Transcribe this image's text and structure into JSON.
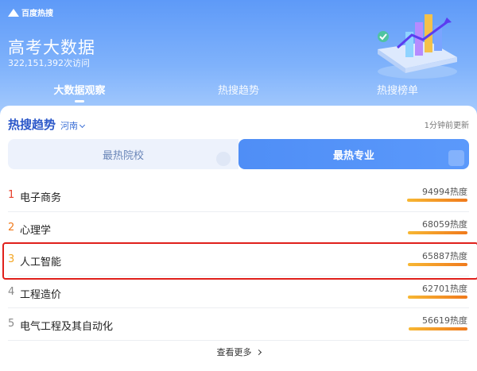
{
  "brand": {
    "name": "百度热搜"
  },
  "header": {
    "title": "高考大数据",
    "visits": "322,151,392次访问",
    "tabs": [
      "大数据观察",
      "热搜趋势",
      "热搜榜单"
    ]
  },
  "card": {
    "title": "热搜趋势",
    "region": "河南",
    "updated": "1分钟前更新",
    "segments": [
      "最热院校",
      "最热专业"
    ],
    "active_segment": "最热专业",
    "more_label": "查看更多"
  },
  "list": [
    {
      "rank": "1",
      "name": "电子商务",
      "heat": "94994热度",
      "heat_value": 94994,
      "rank_color": "#e8412c"
    },
    {
      "rank": "2",
      "name": "心理学",
      "heat": "68059热度",
      "heat_value": 68059,
      "rank_color": "#f07a1c"
    },
    {
      "rank": "3",
      "name": "人工智能",
      "heat": "65887热度",
      "heat_value": 65887,
      "rank_color": "#f4a623"
    },
    {
      "rank": "4",
      "name": "工程造价",
      "heat": "62701热度",
      "heat_value": 62701,
      "rank_color": "#888888"
    },
    {
      "rank": "5",
      "name": "电气工程及其自动化",
      "heat": "56619热度",
      "heat_value": 56619,
      "rank_color": "#888888"
    }
  ],
  "highlighted_rank": "3",
  "colors": {
    "accent": "#4f8ef6",
    "heat_bar": "#f07a1c",
    "highlight_border": "#e0201b"
  }
}
